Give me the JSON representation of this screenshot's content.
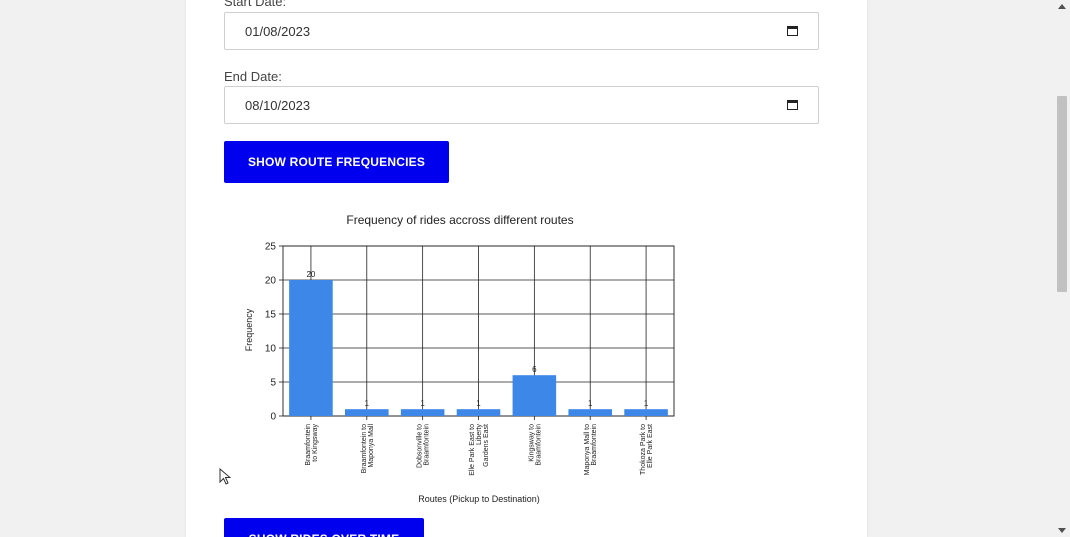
{
  "form": {
    "start_label": "Start Date:",
    "start_value": "01/08/2023",
    "end_label": "End Date:",
    "end_value": "08/10/2023",
    "route_button": "SHOW ROUTE FREQUENCIES",
    "rides_button": "SHOW RIDES OVER TIME"
  },
  "colors": {
    "button": "#0000ee",
    "bar": "#3d87e8"
  },
  "chart_data": {
    "type": "bar",
    "title": "Frequency of rides accross different routes",
    "xlabel": "Routes (Pickup to Destination)",
    "ylabel": "Frequency",
    "ylim": [
      0,
      25
    ],
    "yticks": [
      0,
      5,
      10,
      15,
      20,
      25
    ],
    "grid": true,
    "categories": [
      [
        "Braamfontein",
        "to Kingsway"
      ],
      [
        "Braamfontein to",
        "Maponya Mall"
      ],
      [
        "Dobsonville to",
        "Braamfontein"
      ],
      [
        "Elle Park East to",
        "Liberty",
        "Gardens East"
      ],
      [
        "Kingsway to",
        "Braamfontein"
      ],
      [
        "Maponya Mall to",
        "Braamfontein"
      ],
      [
        "Thokoza Park to",
        "Elle Park East"
      ]
    ],
    "values": [
      20,
      1,
      1,
      1,
      6,
      1,
      1
    ]
  }
}
